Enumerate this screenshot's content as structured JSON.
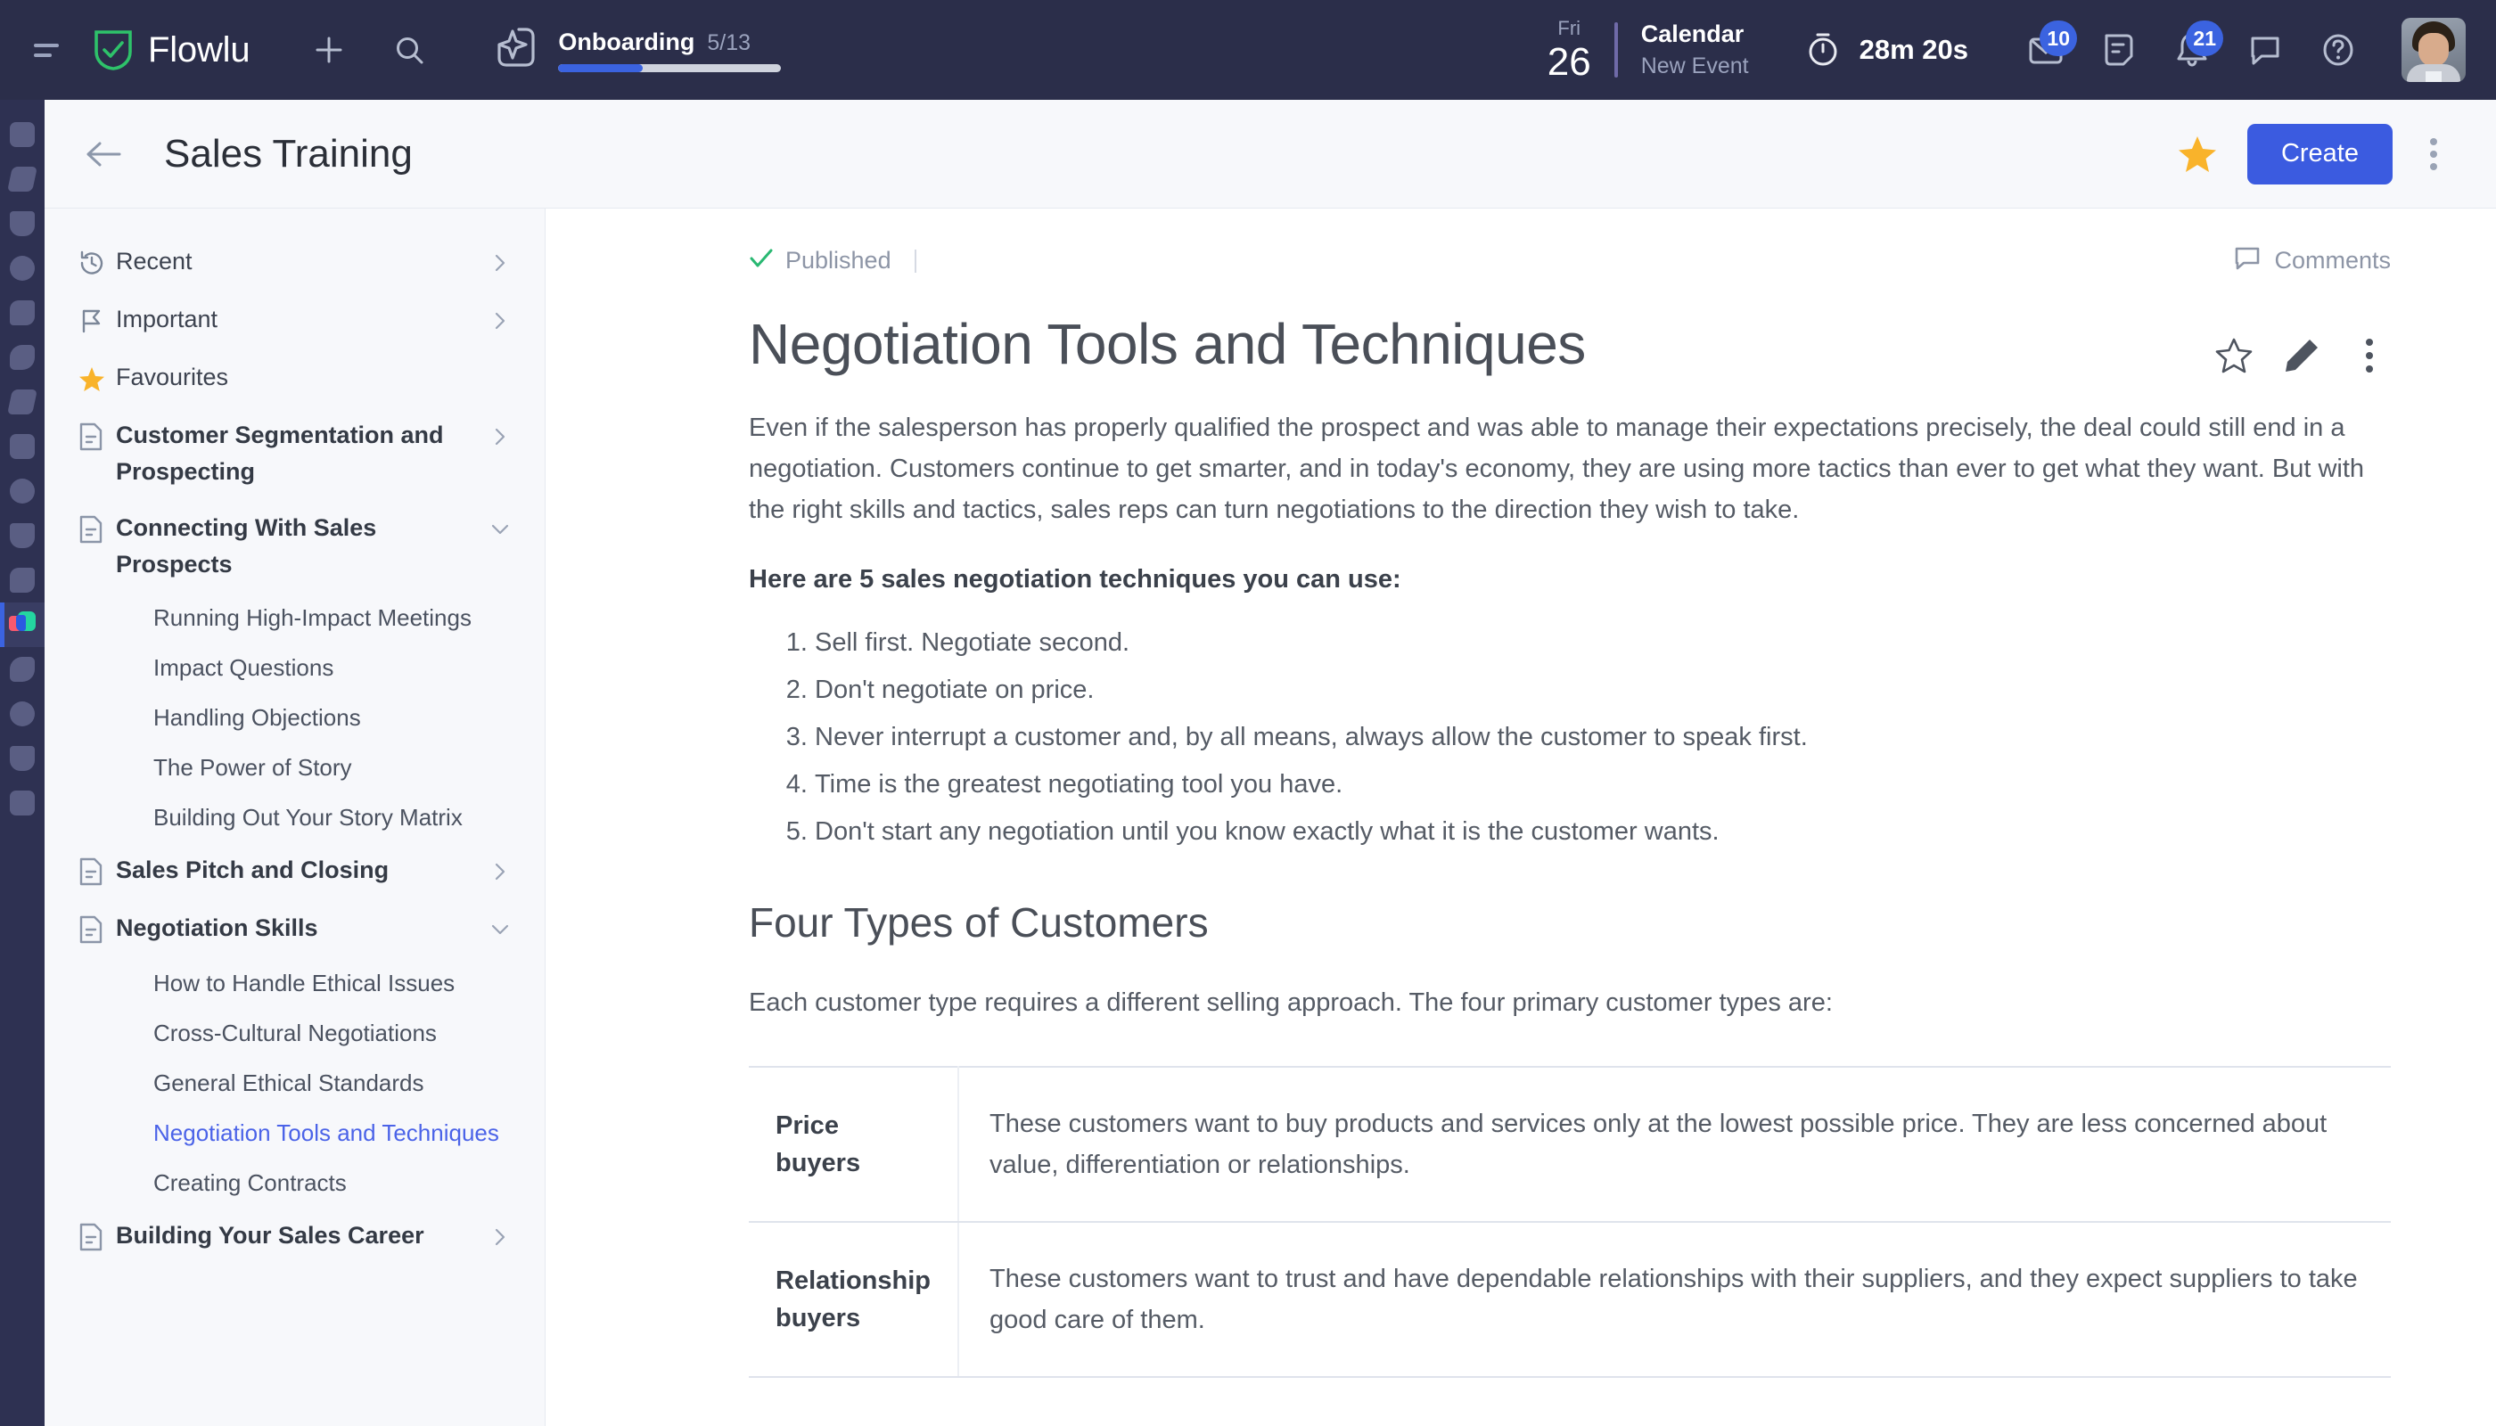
{
  "topbar": {
    "brand_name": "Flowlu",
    "onboarding": {
      "label": "Onboarding",
      "count": "5/13",
      "progress_percent": 38
    },
    "calendar": {
      "weekday": "Fri",
      "day": "26",
      "title": "Calendar",
      "subtitle": "New Event"
    },
    "timer": {
      "value": "28m 20s"
    },
    "mail_badge": "10",
    "bell_badge": "21",
    "accent_color": "#3b63e0",
    "bar_color": "#2b2e4a"
  },
  "page_header": {
    "title": "Sales Training",
    "create_label": "Create",
    "star_color": "#f9b32b",
    "create_color": "#3b5be0"
  },
  "sidebar": {
    "items": [
      {
        "label": "Recent",
        "icon": "history-icon",
        "chevron": "right",
        "type": "link"
      },
      {
        "label": "Important",
        "icon": "flag-icon",
        "chevron": "right",
        "type": "link"
      },
      {
        "label": "Favourites",
        "icon": "star-icon",
        "chevron": "none",
        "type": "link"
      },
      {
        "label": "Customer Segmentation and Prospecting",
        "icon": "document-icon",
        "chevron": "right",
        "type": "group"
      },
      {
        "label": "Connecting With Sales Prospects",
        "icon": "document-icon",
        "chevron": "down",
        "type": "group"
      }
    ],
    "connecting_children": [
      "Running High-Impact Meetings",
      "Impact Questions",
      "Handling Objections",
      "The Power of Story",
      "Building Out Your Story Matrix"
    ],
    "sales_pitch": {
      "label": "Sales Pitch and Closing",
      "icon": "document-icon",
      "chevron": "right"
    },
    "negotiation": {
      "label": "Negotiation Skills",
      "icon": "document-icon",
      "chevron": "down"
    },
    "negotiation_children": [
      {
        "label": "How to Handle Ethical Issues",
        "active": false
      },
      {
        "label": "Cross-Cultural Negotiations",
        "active": false
      },
      {
        "label": "General Ethical Standards",
        "active": false
      },
      {
        "label": "Negotiation Tools and Techniques",
        "active": true
      },
      {
        "label": "Creating Contracts",
        "active": false
      }
    ],
    "building_career": {
      "label": "Building Your Sales Career",
      "icon": "document-icon",
      "chevron": "right"
    },
    "active_color": "#4b63e8"
  },
  "article": {
    "status": "Published",
    "status_color": "#29b872",
    "comments_label": "Comments",
    "title": "Negotiation Tools and Techniques",
    "intro": "Even if the salesperson has properly qualified the prospect and was able to manage their expectations precisely, the deal could still end in a negotiation. Customers continue to get smarter, and in today's economy, they are using more tactics than ever to get what they want. But with the right skills and tactics, sales reps can turn negotiations to the direction they wish to take.",
    "lead_in": "Here are 5 sales negotiation techniques you can use:",
    "techniques": [
      "Sell first. Negotiate second.",
      "Don't negotiate on price.",
      "Never interrupt a customer and, by all means, always allow the customer to speak first.",
      "Time is the greatest negotiating tool you have.",
      "Don't start any negotiation until you know exactly what it is the customer wants."
    ],
    "section_heading": "Four Types of Customers",
    "section_intro": "Each customer type requires a different selling approach. The four primary customer types are:",
    "table": [
      {
        "type": "Price buyers",
        "description": "These customers want to buy products and services only at the lowest possible price. They are less concerned about value, differentiation or relationships."
      },
      {
        "type": "Relationship buyers",
        "description": "These customers want to trust and have dependable relationships with their suppliers, and they expect suppliers to take good care of them."
      }
    ]
  }
}
